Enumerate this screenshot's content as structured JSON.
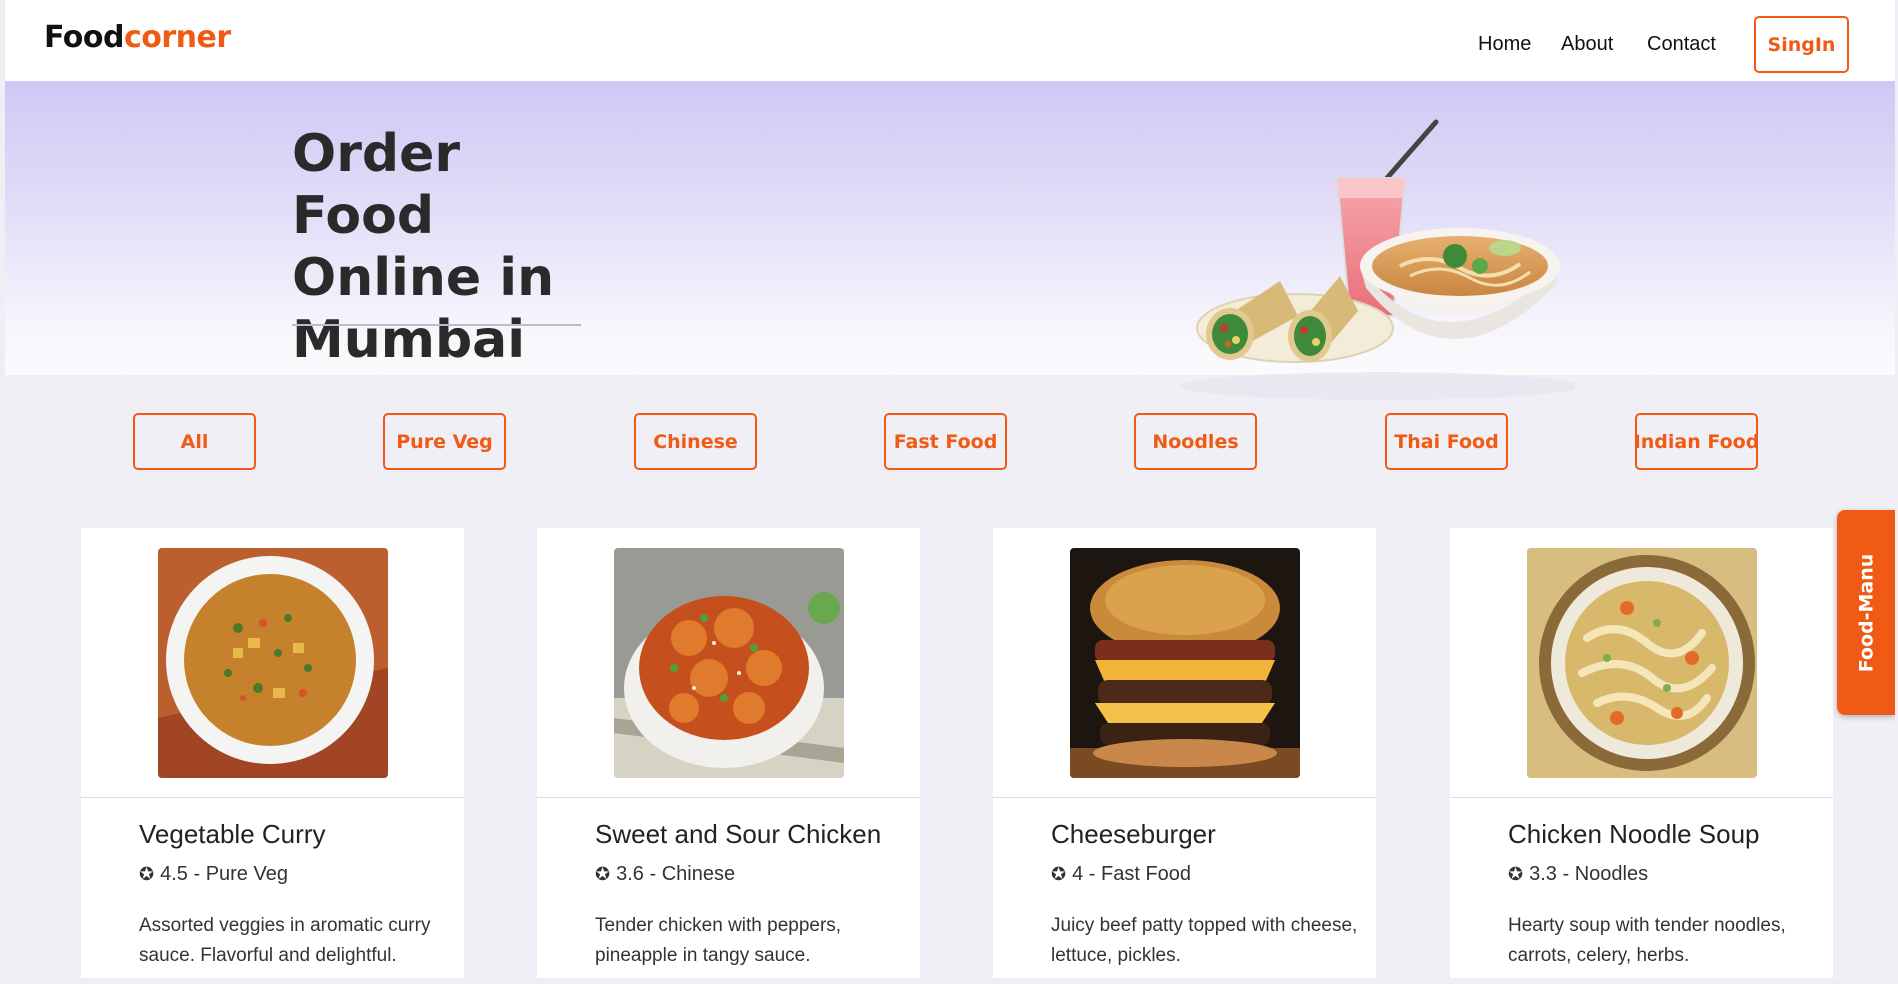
{
  "header": {
    "logo_part1": "Food",
    "logo_part2": "corner",
    "nav": {
      "home": "Home",
      "about": "About",
      "contact": "Contact"
    },
    "signin_label": "SingIn"
  },
  "hero": {
    "title": "Order Food Online in Mumbai"
  },
  "filters": [
    "All",
    "Pure Veg",
    "Chinese",
    "Fast Food",
    "Noodles",
    "Thai Food",
    "Indian Food"
  ],
  "side_tab": {
    "label": "Food-Manu"
  },
  "cards": [
    {
      "title": "Vegetable Curry",
      "rating": "4.5",
      "category": "Pure Veg",
      "description": "Assorted veggies in aromatic curry sauce. Flavorful and delightful.",
      "image_icon": "vegetable-curry-photo"
    },
    {
      "title": "Sweet and Sour Chicken",
      "rating": "3.6",
      "category": "Chinese",
      "description": "Tender chicken with peppers, pineapple in tangy sauce.",
      "image_icon": "sweet-sour-chicken-photo"
    },
    {
      "title": "Cheeseburger",
      "rating": "4",
      "category": "Fast Food",
      "description": "Juicy beef patty topped with cheese, lettuce, pickles.",
      "image_icon": "cheeseburger-photo"
    },
    {
      "title": "Chicken Noodle Soup",
      "rating": "3.3",
      "category": "Noodles",
      "description": "Hearty soup with tender noodles, carrots, celery, herbs.",
      "image_icon": "chicken-noodle-soup-photo"
    }
  ],
  "colors": {
    "accent": "#f05a14",
    "hero_top": "#d0c8f4",
    "page_bg": "#f0eff5"
  }
}
